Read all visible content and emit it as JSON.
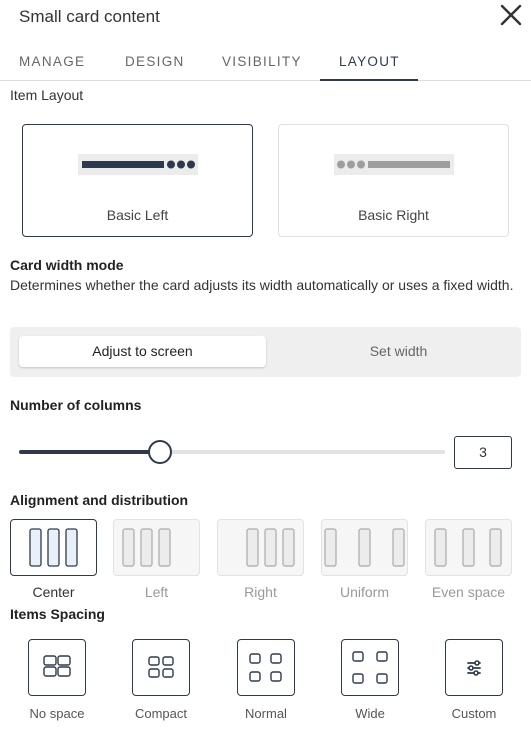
{
  "header": {
    "title": "Small card content",
    "close_icon": "close-icon"
  },
  "tabs": [
    {
      "label": "MANAGE",
      "active": false
    },
    {
      "label": "DESIGN",
      "active": false
    },
    {
      "label": "VISIBILITY",
      "active": false
    },
    {
      "label": "LAYOUT",
      "active": true
    }
  ],
  "item_layout": {
    "label": "Item Layout",
    "options": [
      {
        "label": "Basic Left",
        "selected": true
      },
      {
        "label": "Basic Right",
        "selected": false
      }
    ]
  },
  "card_width": {
    "label": "Card width mode",
    "description": "Determines whether the card adjusts its width automatically or uses a fixed width.",
    "options": [
      {
        "label": "Adjust to screen",
        "selected": true
      },
      {
        "label": "Set width",
        "selected": false
      }
    ]
  },
  "columns": {
    "label": "Number of columns",
    "value": "3",
    "slider_fraction": 0.33
  },
  "alignment": {
    "label": "Alignment and distribution",
    "options": [
      {
        "label": "Center",
        "selected": true
      },
      {
        "label": "Left",
        "selected": false
      },
      {
        "label": "Right",
        "selected": false
      },
      {
        "label": "Uniform",
        "selected": false
      },
      {
        "label": "Even space",
        "selected": false
      }
    ]
  },
  "spacing": {
    "label": "Items Spacing",
    "options": [
      {
        "label": "No space",
        "icon": "grid-no-space-icon"
      },
      {
        "label": "Compact",
        "icon": "grid-compact-icon"
      },
      {
        "label": "Normal",
        "icon": "grid-normal-icon"
      },
      {
        "label": "Wide",
        "icon": "grid-wide-icon"
      },
      {
        "label": "Custom",
        "icon": "sliders-icon"
      }
    ]
  },
  "colors": {
    "accent": "#2e3a4c",
    "muted_bar": "#9e9e9e",
    "panel_bg": "#efefef"
  }
}
